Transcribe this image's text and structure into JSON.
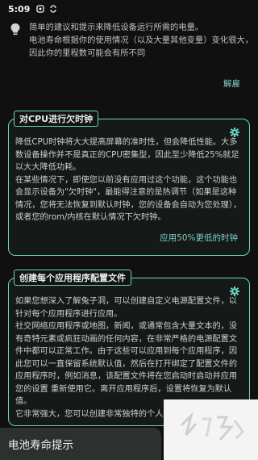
{
  "status_bar": {
    "time": "5:09"
  },
  "intro": {
    "line1": "简单的建议和提示来降低设备运行所需的电量。",
    "line2": "电池寿命根据你的使用情况（以及大量其他变量）变化很大，因此你的里程数可能会有所不同",
    "dismiss_label": "解雇"
  },
  "cards": [
    {
      "tag": "对CPU进行欠时钟",
      "para1": "降低CPU时钟将大大提高屏幕的准时性，但会降低性能。大多数设备操作并不是真正的CPU密集型，因此至少降低25%就足以大大降低功耗。",
      "para2": "在某些情况下，即使您以前没有应用过这个功能，这个功能也会显示设备为\"欠时钟\"，最能得注意的是热调节（如果是这种情况，您将无法恢复到默认时钟，您的设备会自动为您处理），或者您的rom/内核在默认情况下欠时钟。",
      "action_label": "应用50%更低的时钟"
    },
    {
      "tag": "创建每个应用程序配置文件",
      "para1": "如果您想深入了解兔子洞，可以创建自定义电源配置文件，以针对每个应用程序进行应用。",
      "para2": "社交网络应用程序或地图，新闻，或通常包含大量文本的，没有奇特元素或疯狂动画的任何内容，在非常严格的电源配置文件中都可以正常工作。由于这些可以应用到每个应用程序，因此您可以一直保留系统默认值，然后在打开绑定了配置文件的应用程序时，例如消息，该配置文件将在您启动时启动并应用您的设置 重新使用它。离开应用程序后，设置将恢复为默认值。",
      "para3": "它非常强大，您可以创建非常独特的个人体验"
    }
  ],
  "bottom_sheet": {
    "title": "电池寿命提示"
  },
  "icons": {
    "status": [
      "notification-icon",
      "sync-icon"
    ],
    "intro": "lightbulb-icon",
    "card": "gear-icon"
  },
  "colors": {
    "background": "#101010",
    "accent": "#6ad3c1",
    "link": "#7ecfc6"
  }
}
